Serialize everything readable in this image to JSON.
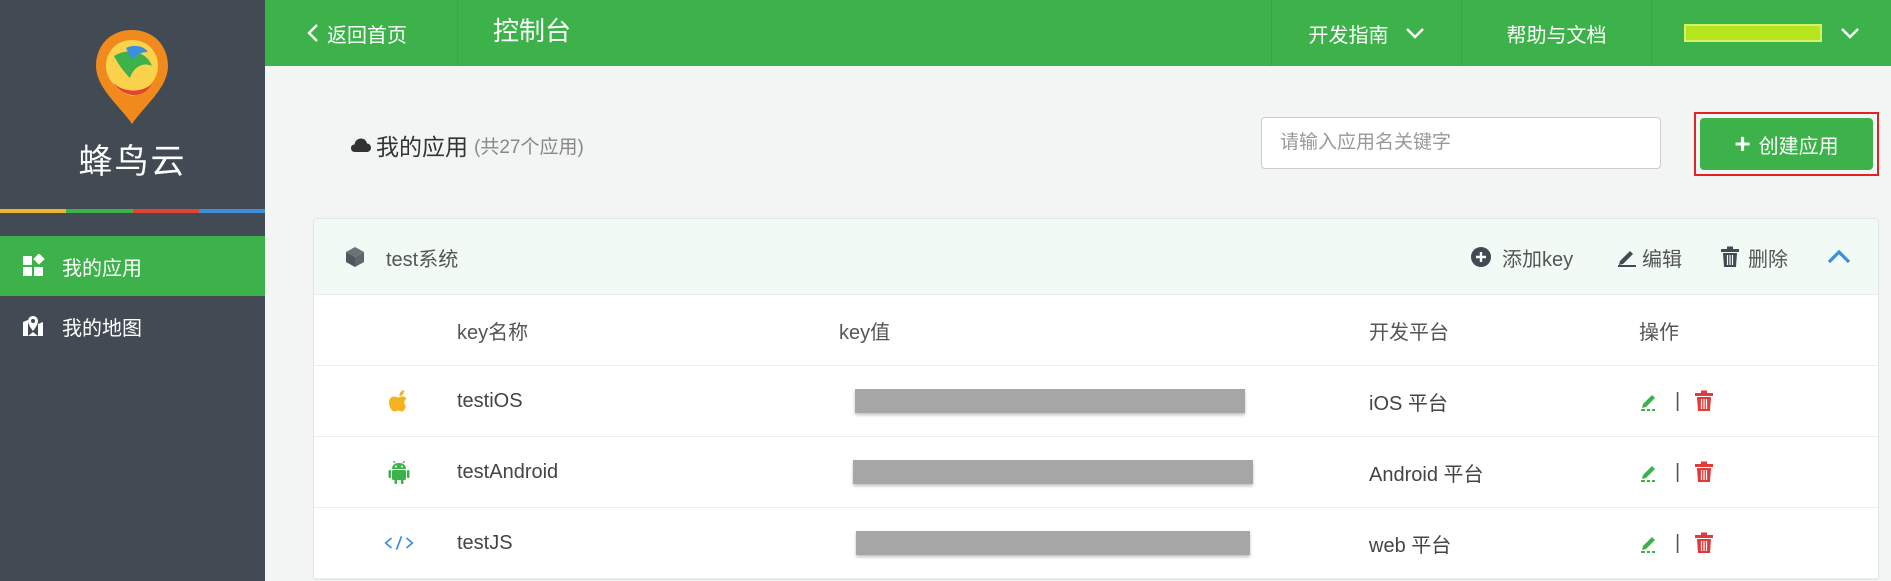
{
  "sidebar": {
    "brand": "蜂鸟云",
    "rainbow_colors": [
      "#f0b429",
      "#3db24b",
      "#e2442f",
      "#3c8fdc"
    ],
    "items": [
      {
        "label": "我的应用",
        "icon": "apps-icon",
        "active": true
      },
      {
        "label": "我的地图",
        "icon": "map-pin-icon",
        "active": false
      }
    ]
  },
  "topbar": {
    "back_label": "返回首页",
    "title": "控制台",
    "guide_label": "开发指南",
    "help_label": "帮助与文档",
    "user_name_color": "#b5e61d"
  },
  "page": {
    "heading": "我的应用",
    "count_text": "(共27个应用)",
    "search_placeholder": "请输入应用名关键字",
    "create_label": "创建应用"
  },
  "app": {
    "name": "test系统",
    "actions": {
      "add_key": "添加key",
      "edit": "编辑",
      "delete": "删除"
    },
    "columns": {
      "name": "key名称",
      "value": "key值",
      "platform": "开发平台",
      "ops": "操作"
    },
    "keys": [
      {
        "icon": "apple-icon",
        "name": "testiOS",
        "platform": "iOS 平台"
      },
      {
        "icon": "android-icon",
        "name": "testAndroid",
        "platform": "Android 平台"
      },
      {
        "icon": "code-icon",
        "name": "testJS",
        "platform": "web 平台"
      }
    ]
  },
  "colors": {
    "primary": "#3db24b",
    "danger": "#e03a3a",
    "sidebar": "#424a53",
    "highlight_box": "#e02424"
  }
}
